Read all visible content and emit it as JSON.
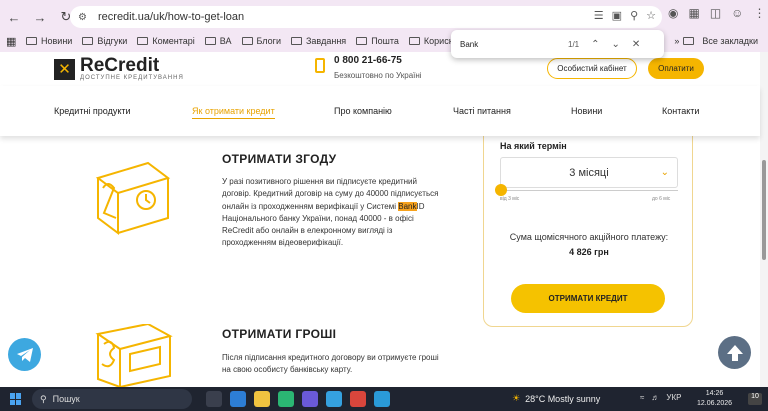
{
  "browser": {
    "url": "recredit.ua/uk/how-to-get-loan",
    "bookmarks": [
      "Новини",
      "Відгуки",
      "Коментарі",
      "ВА",
      "Блоги",
      "Завдання",
      "Пошта",
      "Корисні посилан..."
    ],
    "all_bookmarks": "Все закладки",
    "find": {
      "query": "Bank",
      "count": "1/1"
    }
  },
  "header": {
    "logo_name": "ReCredit",
    "logo_tagline": "ДОСТУПНЕ КРЕДИТУВАННЯ",
    "phone": "0 800 21-66-75",
    "phone_note": "Безкоштовно по Україні",
    "cabinet_button": "Особистий кабінет",
    "pay_button": "Оплатити"
  },
  "menu": [
    "Кредитні продукти",
    "Як отримати кредит",
    "Про компанію",
    "Часті питання",
    "Новини",
    "Контакти"
  ],
  "steps": [
    {
      "title": "ОТРИМАТИ ЗГОДУ",
      "text_before": "У разі позитивного рішення ви підписуєте кредитний договір. Кредитний договір на суму до 40000 підписується онлайн із проходженням верифікації у Системі ",
      "highlight": "Bank",
      "text_after": "ID Національного банку України, понад 40000 - в офісі ReCredit або онлайн в елекронному вигляді із проходженням відеоверифікації."
    },
    {
      "title": "ОТРИМАТИ ГРОШІ",
      "text": "Після підписання кредитного договору ви отримуєте гроші на свою особисту банківську карту."
    }
  ],
  "calculator": {
    "term_label": "На який термін",
    "term_value": "3 місяці",
    "slider_min": "від 3 міс",
    "slider_max": "до 6 міс",
    "slider_fraction": 0,
    "payment_label": "Сума щомісячного акційного платежу:",
    "payment_value": "4 826 грн",
    "submit": "ОТРИМАТИ КРЕДИТ"
  },
  "taskbar": {
    "search": "Пошук",
    "weather": "28°C  Mostly sunny",
    "lang": "УКР",
    "time": "14:26",
    "date": "12.06.2026",
    "notifications": "10"
  }
}
